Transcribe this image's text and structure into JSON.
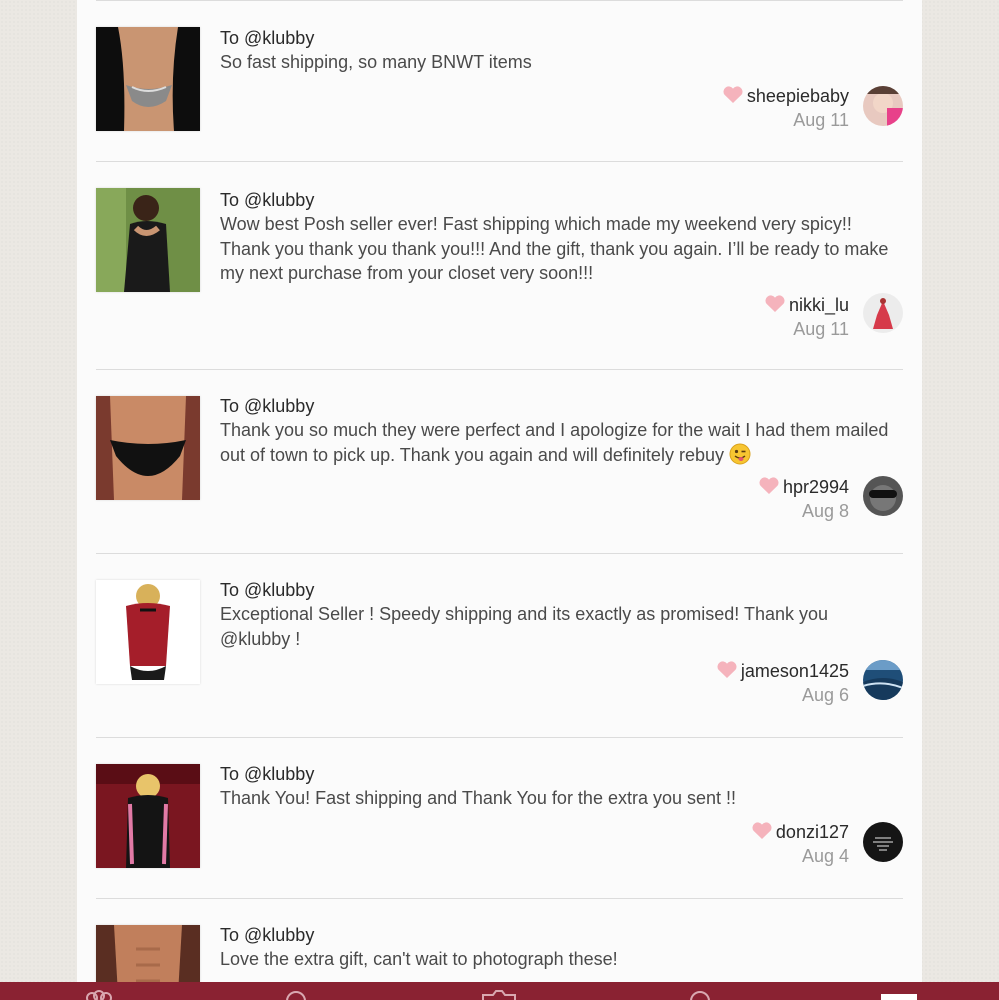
{
  "colors": {
    "brand": "#8a2232",
    "heart": "#f5b3bc",
    "background": "#ebe8e3",
    "panel": "#fbfbfb"
  },
  "reviews": [
    {
      "to": "To @klubby",
      "message": "So fast shipping, so many BNWT items",
      "user": "sheepiebaby",
      "date": "Aug 11",
      "thumb_icon": "lingerie-thong-photo",
      "avatar_icon": "selfie-avatar"
    },
    {
      "to": "To @klubby",
      "message": "Wow best Posh seller ever! Fast shipping which made my weekend very spicy!! Thank you thank you thank you!!! And the gift, thank you again. I’ll be ready to make my next purchase from your closet very soon!!!",
      "user": "nikki_lu",
      "date": "Aug 11",
      "thumb_icon": "black-babydoll-photo",
      "avatar_icon": "red-dress-avatar"
    },
    {
      "to": "To @klubby",
      "message": "Thank you so much they were perfect and I apologize for the wait I had them mailed out of town to pick up. Thank you again and will definitely rebuy",
      "emoji": "wink-tongue-emoji",
      "user": "hpr2994",
      "date": "Aug 8",
      "thumb_icon": "mens-brief-photo",
      "avatar_icon": "sunglasses-avatar"
    },
    {
      "to": "To @klubby",
      "message": "Exceptional Seller ! Speedy shipping and its exactly as promised! Thank you @klubby !",
      "user": "jameson1425",
      "date": "Aug 6",
      "thumb_icon": "red-corset-photo",
      "avatar_icon": "ocean-avatar"
    },
    {
      "to": "To @klubby",
      "message": "Thank You! Fast shipping and Thank You for the extra you sent !!",
      "user": "donzi127",
      "date": "Aug 4",
      "thumb_icon": "pink-black-lingerie-photo",
      "avatar_icon": "quote-text-avatar"
    },
    {
      "to": "To @klubby",
      "message": "Love the extra gift, can't wait to photograph these!",
      "thumb_icon": "male-torso-photo"
    }
  ],
  "tabbar": {
    "icons": [
      "feed-icon",
      "search-icon",
      "camera-icon",
      "notifications-icon",
      "account-icon"
    ]
  }
}
